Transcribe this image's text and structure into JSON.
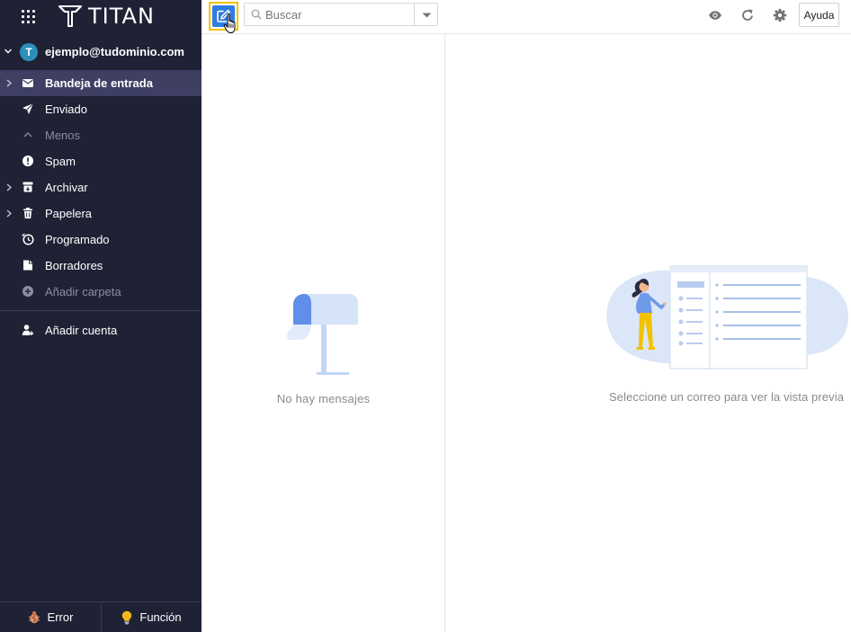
{
  "brand": {
    "name": "TITAN"
  },
  "account": {
    "initial": "T",
    "email": "ejemplo@tudominio.com"
  },
  "folders": [
    {
      "label": "Bandeja de entrada",
      "icon": "envelope-icon",
      "active": true,
      "expandable": true
    },
    {
      "label": "Enviado",
      "icon": "paper-plane-icon",
      "active": false,
      "expandable": false
    },
    {
      "label": "Menos",
      "icon": "chevron-up-icon",
      "muted": true
    },
    {
      "label": "Spam",
      "icon": "exclamation-circle-icon"
    },
    {
      "label": "Archivar",
      "icon": "archive-icon",
      "expandable": true
    },
    {
      "label": "Papelera",
      "icon": "trash-icon",
      "expandable": true
    },
    {
      "label": "Programado",
      "icon": "scheduled-clock-icon"
    },
    {
      "label": "Borradores",
      "icon": "drafts-icon"
    },
    {
      "label": "Añadir carpeta",
      "icon": "add-folder-icon",
      "muted": true
    }
  ],
  "add_account": {
    "label": "Añadir cuenta"
  },
  "bottom": {
    "error_label": "Error",
    "feature_label": "Función"
  },
  "toolbar": {
    "search_placeholder": "Buscar",
    "help_label": "Ayuda"
  },
  "list": {
    "empty_text": "No hay mensajes"
  },
  "preview": {
    "empty_text": "Seleccione un correo para ver la vista previa"
  },
  "colors": {
    "sidebar_bg": "#1f2235",
    "active_folder_bg": "#3e3f63",
    "accent": "#2f7de1",
    "highlight": "#f3c300"
  }
}
